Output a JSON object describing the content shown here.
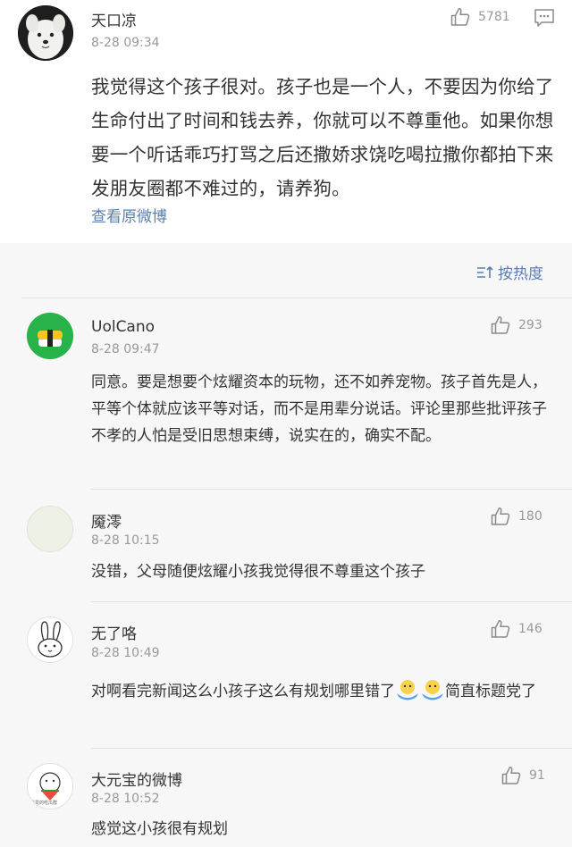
{
  "main_post": {
    "author": "天口凉",
    "time": "8-28 09:34",
    "likes": "5781",
    "text": "我觉得这个孩子很对。孩子也是一个人，不要因为你给了生命付出了时间和钱去养，你就可以不尊重他。如果你想要一个听话乖巧打骂之后还撒娇求饶吃喝拉撒你都拍下来发朋友圈都不难过的，请养狗。",
    "view_original": "查看原微博"
  },
  "sort": {
    "label": "按热度"
  },
  "comments": [
    {
      "author": "UolCano",
      "time": "8-28 09:47",
      "likes": "293",
      "text": "同意。要是想要个炫耀资本的玩物，还不如养宠物。孩子首先是人，平等个体就应该平等对话，而不是用辈分说话。评论里那些批评孩子不孝的人怕是受旧思想束缚，说实在的，确实不配。"
    },
    {
      "author": "魇澪",
      "time": "8-28 10:15",
      "likes": "180",
      "text": "没错，父母随便炫耀小孩我觉得很不尊重这个孩子"
    },
    {
      "author": "无了咯",
      "time": "8-28 10:49",
      "likes": "146",
      "text_before": "对啊看完新闻这么小孩子这么有规划哪里错了",
      "text_after": "简直标题党了"
    },
    {
      "author": "大元宝的微博",
      "time": "8-28 10:52",
      "likes": "91",
      "text": "感觉这小孩很有规划",
      "avatar_caption": "最爱的吃瓜群"
    }
  ],
  "icons": {
    "like": "thumbs-up-icon",
    "comment": "comment-icon",
    "sort": "sort-icon",
    "emoji": "doge-hug-emoji"
  }
}
